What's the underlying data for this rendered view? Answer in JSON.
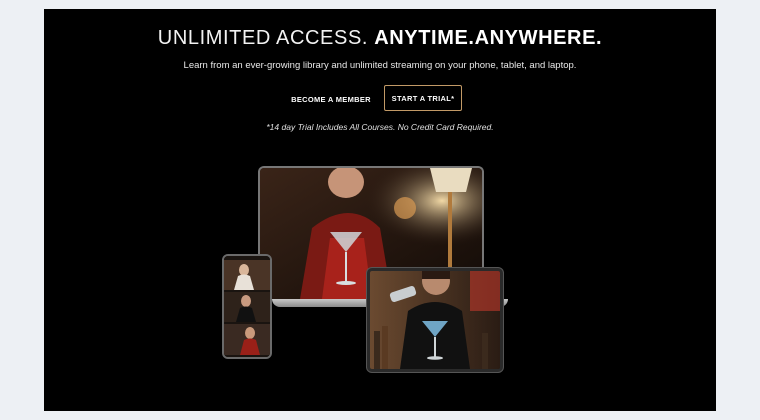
{
  "hero": {
    "headline_light": "UNLIMITED ACCESS.",
    "headline_bold": "ANYTIME.ANYWHERE.",
    "subline": "Learn from an ever-growing library and unlimited streaming on your phone, tablet, and laptop.",
    "note": "*14 day Trial Includes All Courses. No Credit Card Required."
  },
  "actions": {
    "member_label": "BECOME A MEMBER",
    "trial_label": "START A TRIAL*"
  },
  "colors": {
    "panel_bg": "#000000",
    "page_bg": "#edf0f4",
    "accent_border": "#c29a67"
  },
  "devices": [
    "laptop",
    "phone",
    "tablet"
  ]
}
